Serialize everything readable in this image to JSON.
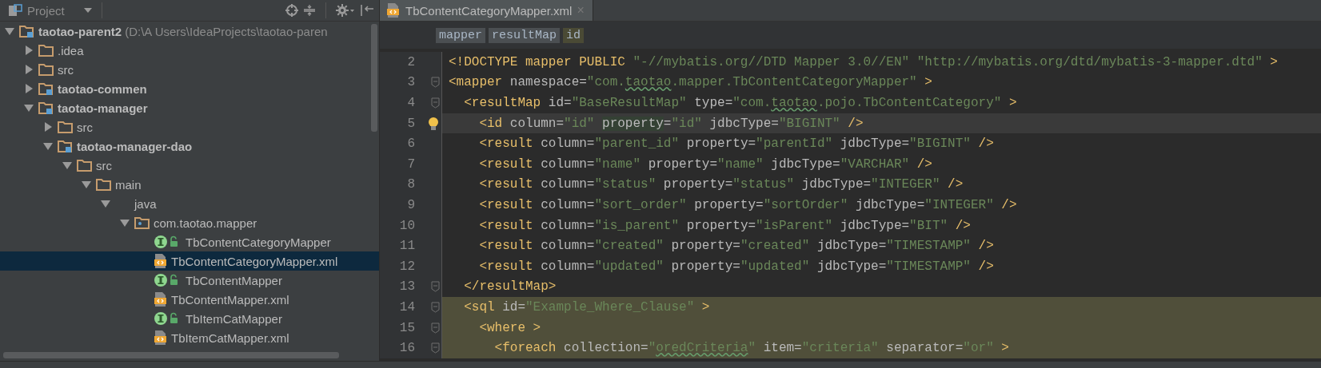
{
  "project_panel": {
    "title": "Project",
    "tree": [
      {
        "label": "taotao-parent2",
        "path": "(D:\\A Users\\IdeaProjects\\taotao-paren",
        "kind": "module",
        "bold": true,
        "expanded": true,
        "selected": false,
        "children": [
          {
            "label": ".idea",
            "kind": "folder",
            "bold": false,
            "expanded": false,
            "selected": false
          },
          {
            "label": "src",
            "kind": "folder",
            "bold": false,
            "expanded": false,
            "selected": false
          },
          {
            "label": "taotao-commen",
            "kind": "module",
            "bold": true,
            "expanded": false,
            "selected": false
          },
          {
            "label": "taotao-manager",
            "kind": "module",
            "bold": true,
            "expanded": true,
            "selected": false,
            "children": [
              {
                "label": "src",
                "kind": "folder",
                "bold": false,
                "expanded": false,
                "selected": false
              },
              {
                "label": "taotao-manager-dao",
                "kind": "module",
                "bold": true,
                "expanded": true,
                "selected": false,
                "children": [
                  {
                    "label": "src",
                    "kind": "folder",
                    "bold": false,
                    "expanded": true,
                    "selected": false,
                    "children": [
                      {
                        "label": "main",
                        "kind": "folder",
                        "bold": false,
                        "expanded": true,
                        "selected": false,
                        "children": [
                          {
                            "label": "java",
                            "bold": false,
                            "expanded": true,
                            "selected": false,
                            "children": [
                              {
                                "label": "com.taotao.mapper",
                                "kind": "package",
                                "bold": false,
                                "expanded": true,
                                "selected": false,
                                "children": [
                                  {
                                    "label": "TbContentCategoryMapper",
                                    "kind": "interface",
                                    "bold": false,
                                    "selected": false
                                  },
                                  {
                                    "label": "TbContentCategoryMapper.xml",
                                    "kind": "xml",
                                    "bold": false,
                                    "selected": true
                                  },
                                  {
                                    "label": "TbContentMapper",
                                    "kind": "interface",
                                    "bold": false,
                                    "selected": false
                                  },
                                  {
                                    "label": "TbContentMapper.xml",
                                    "kind": "xml",
                                    "bold": false,
                                    "selected": false
                                  },
                                  {
                                    "label": "TbItemCatMapper",
                                    "kind": "interface",
                                    "bold": false,
                                    "selected": false
                                  },
                                  {
                                    "label": "TbItemCatMapper.xml",
                                    "kind": "xml",
                                    "bold": false,
                                    "selected": false
                                  }
                                ]
                              }
                            ]
                          }
                        ]
                      }
                    ]
                  }
                ]
              }
            ]
          }
        ]
      }
    ]
  },
  "editor": {
    "tabs": [
      {
        "label": "TbContentCategoryMapper.xml",
        "close": "×",
        "selected": true
      }
    ],
    "breadcrumbs": [
      {
        "label": "mapper",
        "selected": false
      },
      {
        "label": "resultMap",
        "selected": false
      },
      {
        "label": "id",
        "selected": true
      }
    ],
    "lines": [
      {
        "number": "2",
        "fold": false,
        "bulb": false,
        "current": false,
        "highlighted": false,
        "tokens": [
          {
            "kind": "tag",
            "text": "<!DOCTYPE mapper PUBLIC "
          },
          {
            "kind": "val",
            "text": "\"-//mybatis.org//DTD Mapper 3.0//EN\""
          },
          {
            "kind": "val",
            "text": " \"http://mybatis.org/dtd/mybatis-3-mapper.dtd\""
          },
          {
            "kind": "tag",
            "text": " >"
          }
        ]
      },
      {
        "number": "3",
        "fold": true,
        "bulb": false,
        "current": false,
        "highlighted": false,
        "tokens": [
          {
            "kind": "tag",
            "text": "<mapper"
          },
          {
            "kind": "attr",
            "text": " namespace="
          },
          {
            "kind": "val",
            "text": "\"com."
          },
          {
            "kind": "typo",
            "text": "taotao"
          },
          {
            "kind": "val",
            "text": ".mapper.TbContentCategoryMapper\""
          },
          {
            "kind": "tag",
            "text": " >"
          }
        ]
      },
      {
        "number": "4",
        "fold": true,
        "bulb": false,
        "current": false,
        "highlighted": false,
        "tokens": [
          {
            "kind": "tag",
            "text": "  <resultMap"
          },
          {
            "kind": "attr",
            "text": " id="
          },
          {
            "kind": "val",
            "text": "\"BaseResultMap\""
          },
          {
            "kind": "attr",
            "text": " type="
          },
          {
            "kind": "val",
            "text": "\"com."
          },
          {
            "kind": "typo",
            "text": "taotao"
          },
          {
            "kind": "val",
            "text": ".pojo.TbContentCategory\""
          },
          {
            "kind": "tag",
            "text": " >"
          }
        ]
      },
      {
        "number": "5",
        "fold": false,
        "bulb": true,
        "current": true,
        "highlighted": false,
        "tokens": [
          {
            "kind": "tag",
            "text": "    <id"
          },
          {
            "kind": "attr",
            "text": " column="
          },
          {
            "kind": "val",
            "text": "\"id\" "
          },
          {
            "kind": "usage",
            "text": "property"
          },
          {
            "kind": "attr",
            "text": "="
          },
          {
            "kind": "val",
            "text": "\"id\""
          },
          {
            "kind": "attr",
            "text": " jdbcType="
          },
          {
            "kind": "val",
            "text": "\"BIGINT\""
          },
          {
            "kind": "tag",
            "text": " />"
          }
        ]
      },
      {
        "number": "6",
        "fold": false,
        "bulb": false,
        "current": false,
        "highlighted": false,
        "tokens": [
          {
            "kind": "tag",
            "text": "    <result"
          },
          {
            "kind": "attr",
            "text": " column="
          },
          {
            "kind": "val",
            "text": "\"parent_id\""
          },
          {
            "kind": "attr",
            "text": " property="
          },
          {
            "kind": "val",
            "text": "\"parentId\""
          },
          {
            "kind": "attr",
            "text": " jdbcType="
          },
          {
            "kind": "val",
            "text": "\"BIGINT\""
          },
          {
            "kind": "tag",
            "text": " />"
          }
        ]
      },
      {
        "number": "7",
        "fold": false,
        "bulb": false,
        "current": false,
        "highlighted": false,
        "tokens": [
          {
            "kind": "tag",
            "text": "    <result"
          },
          {
            "kind": "attr",
            "text": " column="
          },
          {
            "kind": "val",
            "text": "\"name\""
          },
          {
            "kind": "attr",
            "text": " property="
          },
          {
            "kind": "val",
            "text": "\"name\""
          },
          {
            "kind": "attr",
            "text": " jdbcType="
          },
          {
            "kind": "val",
            "text": "\"VARCHAR\""
          },
          {
            "kind": "tag",
            "text": " />"
          }
        ]
      },
      {
        "number": "8",
        "fold": false,
        "bulb": false,
        "current": false,
        "highlighted": false,
        "tokens": [
          {
            "kind": "tag",
            "text": "    <result"
          },
          {
            "kind": "attr",
            "text": " column="
          },
          {
            "kind": "val",
            "text": "\"status\""
          },
          {
            "kind": "attr",
            "text": " property="
          },
          {
            "kind": "val",
            "text": "\"status\""
          },
          {
            "kind": "attr",
            "text": " jdbcType="
          },
          {
            "kind": "val",
            "text": "\"INTEGER\""
          },
          {
            "kind": "tag",
            "text": " />"
          }
        ]
      },
      {
        "number": "9",
        "fold": false,
        "bulb": false,
        "current": false,
        "highlighted": false,
        "tokens": [
          {
            "kind": "tag",
            "text": "    <result"
          },
          {
            "kind": "attr",
            "text": " column="
          },
          {
            "kind": "val",
            "text": "\"sort_order\""
          },
          {
            "kind": "attr",
            "text": " property="
          },
          {
            "kind": "val",
            "text": "\"sortOrder\""
          },
          {
            "kind": "attr",
            "text": " jdbcType="
          },
          {
            "kind": "val",
            "text": "\"INTEGER\""
          },
          {
            "kind": "tag",
            "text": " />"
          }
        ]
      },
      {
        "number": "10",
        "fold": false,
        "bulb": false,
        "current": false,
        "highlighted": false,
        "tokens": [
          {
            "kind": "tag",
            "text": "    <result"
          },
          {
            "kind": "attr",
            "text": " column="
          },
          {
            "kind": "val",
            "text": "\"is_parent\""
          },
          {
            "kind": "attr",
            "text": " property="
          },
          {
            "kind": "val",
            "text": "\"isParent\""
          },
          {
            "kind": "attr",
            "text": " jdbcType="
          },
          {
            "kind": "val",
            "text": "\"BIT\""
          },
          {
            "kind": "tag",
            "text": " />"
          }
        ]
      },
      {
        "number": "11",
        "fold": false,
        "bulb": false,
        "current": false,
        "highlighted": false,
        "tokens": [
          {
            "kind": "tag",
            "text": "    <result"
          },
          {
            "kind": "attr",
            "text": " column="
          },
          {
            "kind": "val",
            "text": "\"created\""
          },
          {
            "kind": "attr",
            "text": " property="
          },
          {
            "kind": "val",
            "text": "\"created\""
          },
          {
            "kind": "attr",
            "text": " jdbcType="
          },
          {
            "kind": "val",
            "text": "\"TIMESTAMP\""
          },
          {
            "kind": "tag",
            "text": " />"
          }
        ]
      },
      {
        "number": "12",
        "fold": false,
        "bulb": false,
        "current": false,
        "highlighted": false,
        "tokens": [
          {
            "kind": "tag",
            "text": "    <result"
          },
          {
            "kind": "attr",
            "text": " column="
          },
          {
            "kind": "val",
            "text": "\"updated\""
          },
          {
            "kind": "attr",
            "text": " property="
          },
          {
            "kind": "val",
            "text": "\"updated\""
          },
          {
            "kind": "attr",
            "text": " jdbcType="
          },
          {
            "kind": "val",
            "text": "\"TIMESTAMP\""
          },
          {
            "kind": "tag",
            "text": " />"
          }
        ]
      },
      {
        "number": "13",
        "fold": true,
        "bulb": false,
        "current": false,
        "highlighted": false,
        "tokens": [
          {
            "kind": "tag",
            "text": "  </resultMap>"
          }
        ]
      },
      {
        "number": "14",
        "fold": true,
        "bulb": false,
        "current": false,
        "highlighted": true,
        "tokens": [
          {
            "kind": "tag",
            "text": "  <sql"
          },
          {
            "kind": "attr",
            "text": " id="
          },
          {
            "kind": "val",
            "text": "\"Example_Where_Clause\""
          },
          {
            "kind": "tag",
            "text": " >"
          }
        ]
      },
      {
        "number": "15",
        "fold": true,
        "bulb": false,
        "current": false,
        "highlighted": true,
        "tokens": [
          {
            "kind": "tag",
            "text": "    <where >"
          }
        ]
      },
      {
        "number": "16",
        "fold": true,
        "bulb": false,
        "current": false,
        "highlighted": true,
        "tokens": [
          {
            "kind": "tag",
            "text": "      <foreach"
          },
          {
            "kind": "attr",
            "text": " collection="
          },
          {
            "kind": "val",
            "text": "\""
          },
          {
            "kind": "typo",
            "text": "oredCriteria"
          },
          {
            "kind": "val",
            "text": "\""
          },
          {
            "kind": "attr",
            "text": " item="
          },
          {
            "kind": "val",
            "text": "\"criteria\""
          },
          {
            "kind": "attr",
            "text": " separator="
          },
          {
            "kind": "val",
            "text": "\"or\""
          },
          {
            "kind": "tag",
            "text": " >"
          }
        ]
      }
    ]
  }
}
